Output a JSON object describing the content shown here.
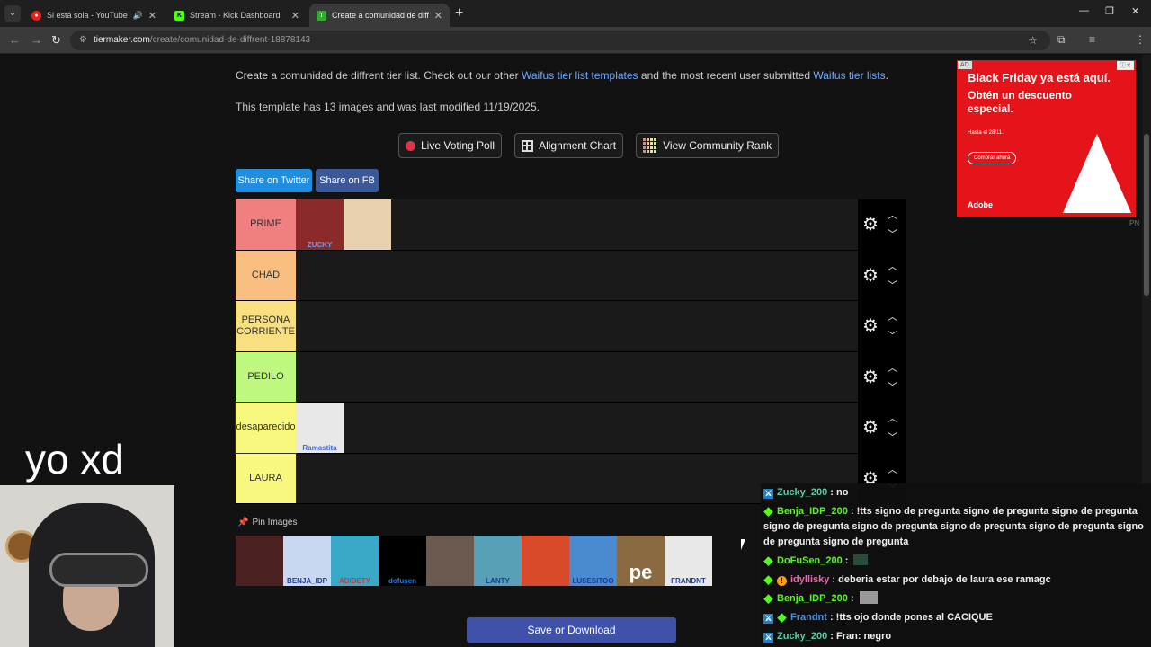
{
  "browser": {
    "tabs": [
      {
        "label": "Si está sola - YouTube Music",
        "favicon_color": "#e62117",
        "active": false
      },
      {
        "label": "Stream - Kick Dashboard",
        "favicon_color": "#53fc18",
        "active": false
      },
      {
        "label": "Create a comunidad de diffrent",
        "favicon_color": "#33aa33",
        "active": true
      }
    ],
    "url_host": "tiermaker.com",
    "url_path": "/create/comunidad-de-diffrent-18878143"
  },
  "page": {
    "intro_text": "Create a comunidad de diffrent tier list. Check out our other",
    "intro_link1": "Waifus tier list templates",
    "intro_mid": "and the most recent user submitted",
    "intro_link2": "Waifus tier lists",
    "intro_end": ".",
    "modified_text": "This template has 13 images and was last modified 11/19/2025.",
    "buttons": {
      "live_voting": "Live Voting Poll",
      "alignment": "Alignment Chart",
      "community_rank": "View Community Rank"
    },
    "share_twitter": "Share on Twitter",
    "share_fb": "Share on FB",
    "tiers": [
      {
        "label": "PRIME",
        "color": "#f07f80"
      },
      {
        "label": "CHAD",
        "color": "#f8bf80"
      },
      {
        "label": "PERSONA CORRIENTE",
        "color": "#f8df80"
      },
      {
        "label": "PEDILO",
        "color": "#bff87f"
      },
      {
        "label": "desaparecido",
        "color": "#f8f87f"
      },
      {
        "label": "LAURA",
        "color": "#f8f87f"
      }
    ],
    "tier_images": {
      "prime": [
        {
          "caption": "ZUCKY",
          "color": "#8b2a2a"
        },
        {
          "caption": "",
          "color": "#e8d0b0"
        }
      ],
      "desaparecido": [
        {
          "caption": "Ramastita",
          "color": "#e8e8e8"
        }
      ]
    },
    "pin_label": "Pin Images",
    "pinned_images": [
      {
        "caption": "",
        "color": "#4a2020"
      },
      {
        "caption": "BENJA_IDP",
        "color": "#c8d8f0"
      },
      {
        "caption": "ADIDETY",
        "color": "#3aa8c8"
      },
      {
        "caption": "dofusen",
        "color": "#000000"
      },
      {
        "caption": "",
        "color": "#6a5a50"
      },
      {
        "caption": "LANTY",
        "color": "#58a0b8"
      },
      {
        "caption": "",
        "color": "#d84a2a"
      },
      {
        "caption": "LUSESITOO",
        "color": "#4a8ad0"
      },
      {
        "caption": "pe",
        "color": "#8a6a40"
      },
      {
        "caption": "FRANDNT",
        "color": "#e8e8e8"
      }
    ],
    "save_label": "Save or Download"
  },
  "ad": {
    "tag": "AD",
    "headline": "Black Friday ya está aquí.",
    "subhead": "Obtén un descuento especial.",
    "date": "Hasta el 28/11.",
    "cta": "Comprar ahora",
    "brand": "Adobe"
  },
  "ad_footer": "PN",
  "overlay_text": "yo xd",
  "chat": [
    {
      "badges": [
        "mod"
      ],
      "user": "Zucky_200",
      "user_color": "#53d0a0",
      "text": ": no"
    },
    {
      "badges": [
        "gem"
      ],
      "user": "Benja_IDP_200",
      "user_color": "#53fc18",
      "text": ": !tts signo de pregunta signo de pregunta signo de pregunta signo de pregunta signo de pregunta signo de pregunta signo de pregunta signo de pregunta signo de pregunta"
    },
    {
      "badges": [
        "gem"
      ],
      "user": "DoFuSen_200",
      "user_color": "#53fc18",
      "text": ":",
      "emote": true
    },
    {
      "badges": [
        "gem",
        "warn"
      ],
      "user": "idyllisky",
      "user_color": "#e86ab0",
      "text": ": deberia estar por debajo de laura ese ramagc"
    },
    {
      "badges": [
        "gem"
      ],
      "user": "Benja_IDP_200",
      "user_color": "#53fc18",
      "text": ":",
      "emote2": true
    },
    {
      "badges": [
        "mod",
        "gem"
      ],
      "user": "Frandnt",
      "user_color": "#4a90e2",
      "text": ": !tts ojo donde pones al CACIQUE"
    },
    {
      "badges": [
        "mod"
      ],
      "user": "Zucky_200",
      "user_color": "#53d0a0",
      "text": ": Fran: negro"
    }
  ]
}
